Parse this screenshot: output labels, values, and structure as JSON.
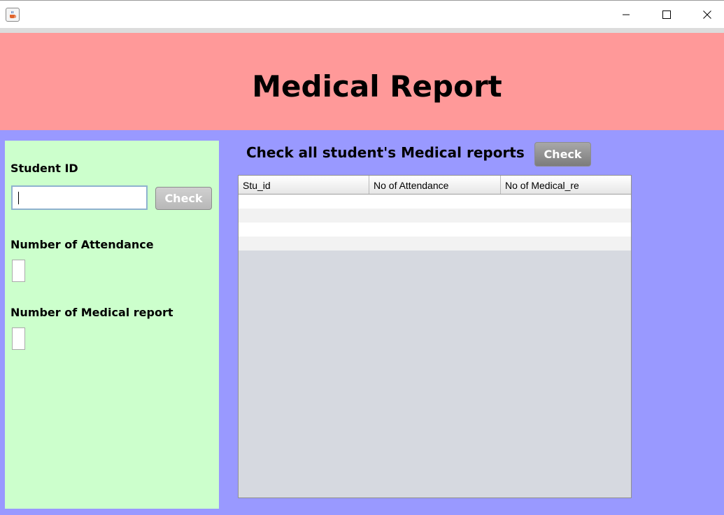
{
  "window": {
    "app_icon": "java-cup-icon",
    "controls": [
      "minimize-icon",
      "maximize-icon",
      "close-icon"
    ]
  },
  "header": {
    "title": "Medical Report",
    "background": "#ff9999"
  },
  "colors": {
    "content_bg": "#9999ff",
    "left_panel_bg": "#ccffcc",
    "table_bg": "#d6d9e0"
  },
  "left_panel": {
    "student_id_label": "Student ID",
    "student_id_value": "",
    "check_label": "Check",
    "attendance_label": "Number of Attendance",
    "attendance_value": "",
    "medical_label": "Number of Medical report",
    "medical_value": ""
  },
  "right_panel": {
    "heading": "Check all student's Medical reports",
    "check_label": "Check",
    "table": {
      "columns": [
        "Stu_id",
        "No of Attendance",
        "No of Medical_re"
      ],
      "rows": [
        [
          "",
          "",
          ""
        ],
        [
          "",
          "",
          ""
        ],
        [
          "",
          "",
          ""
        ],
        [
          "",
          "",
          ""
        ]
      ]
    }
  }
}
